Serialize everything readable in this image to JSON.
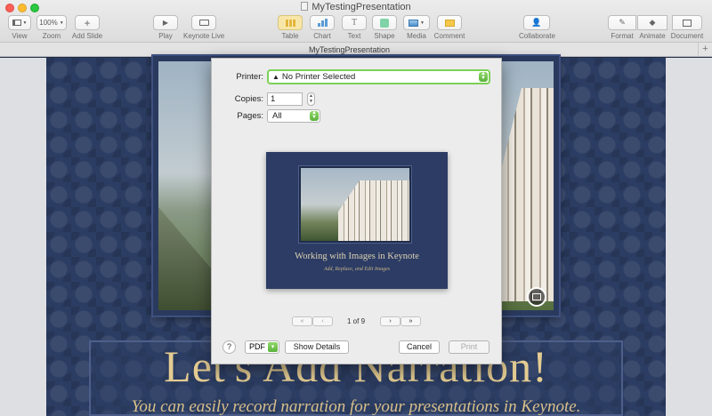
{
  "window": {
    "title": "MyTestingPresentation",
    "tab_title": "MyTestingPresentation",
    "tab_add": "+"
  },
  "toolbar": {
    "view": "View",
    "zoom": "Zoom",
    "zoom_value": "100%",
    "add_slide": "Add Slide",
    "play": "Play",
    "keynote_live": "Keynote Live",
    "table": "Table",
    "chart": "Chart",
    "text": "Text",
    "shape": "Shape",
    "media": "Media",
    "comment": "Comment",
    "collaborate": "Collaborate",
    "format": "Format",
    "animate": "Animate",
    "document": "Document"
  },
  "slide": {
    "title": "Let's Add Narration!",
    "subtitle": "You can easily record narration for your presentations in Keynote."
  },
  "print_dialog": {
    "printer_label": "Printer:",
    "printer_value": "No Printer Selected",
    "copies_label": "Copies:",
    "copies_value": "1",
    "pages_label": "Pages:",
    "pages_value": "All",
    "preview_title": "Working with Images in Keynote",
    "preview_subtitle": "Add, Replace, and Edit Images",
    "page_indicator": "1 of 9",
    "first_page": "«",
    "prev_page": "‹",
    "next_page": "›",
    "last_page": "»",
    "help": "?",
    "pdf": "PDF",
    "show_details": "Show Details",
    "cancel": "Cancel",
    "print": "Print"
  },
  "colors": {
    "accent_green": "#7bd158",
    "slide_bg": "#2c3d63",
    "title_gold": "#e4cc92"
  }
}
